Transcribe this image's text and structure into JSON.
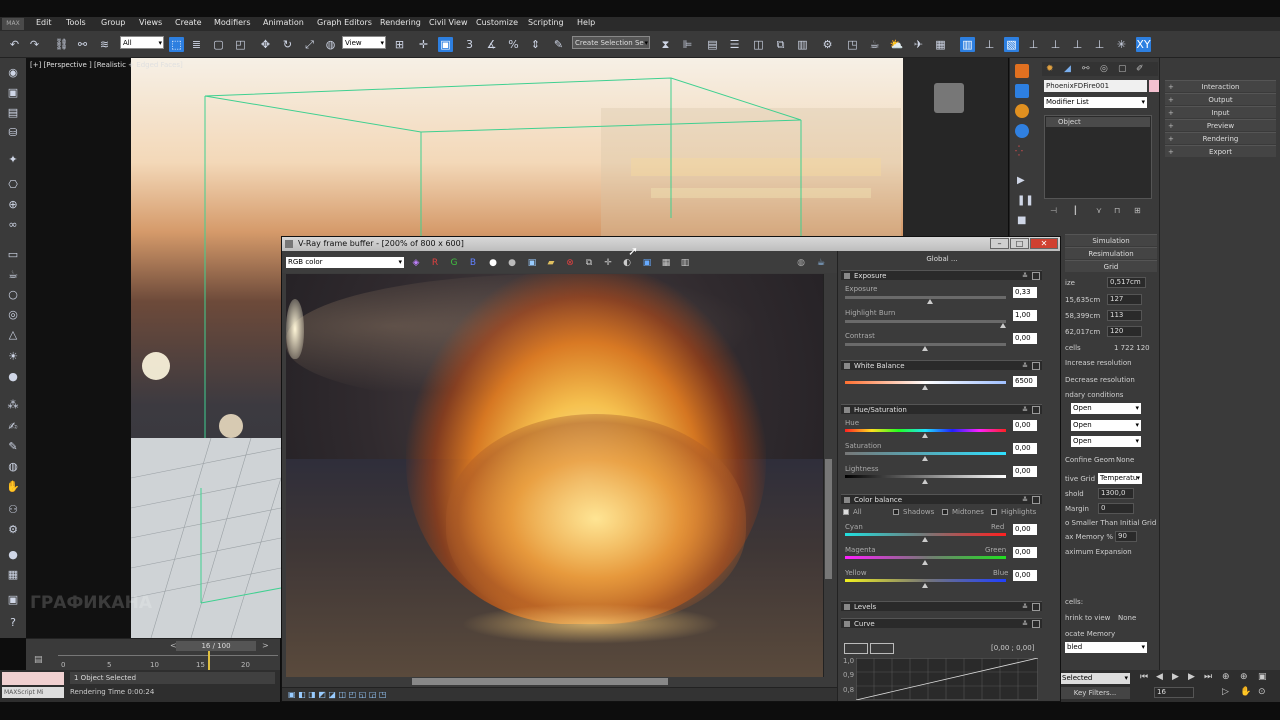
{
  "menu": {
    "logo": "MAX",
    "items": [
      "Edit",
      "Tools",
      "Group",
      "Views",
      "Create",
      "Modifiers",
      "Animation",
      "Graph Editors",
      "Rendering",
      "Civil View",
      "Customize",
      "Scripting",
      "Help"
    ]
  },
  "toolbar": {
    "selection_filter": "All",
    "ref_coord": "View",
    "named_selection": "Create Selection Se"
  },
  "viewport": {
    "label": "[+] [Perspective ] [Realistic + Edged Faces]"
  },
  "timeline": {
    "frame": "16 / 100",
    "ticks": [
      "0",
      "5",
      "10",
      "15",
      "20"
    ]
  },
  "status": {
    "selected": "1 Object Selected",
    "render_time": "Rendering Time 0:00:24",
    "script_label": "MAXScript Mi"
  },
  "bottom_right": {
    "key_mode": "Selected",
    "key_filters": "Key Filters...",
    "frame_field": "16"
  },
  "vfb": {
    "title": "V-Ray frame buffer - [200% of 800 x 600]",
    "channel": "RGB color",
    "rgb": [
      "R",
      "G",
      "B"
    ],
    "global_label": "Global ...",
    "exposure": {
      "name": "Exposure",
      "exposure_label": "Exposure",
      "exposure_val": "0,33",
      "highlight_label": "Highlight Burn",
      "highlight_val": "1,00",
      "contrast_label": "Contrast",
      "contrast_val": "0,00"
    },
    "white_balance": {
      "name": "White Balance",
      "val": "6500"
    },
    "hue_sat": {
      "name": "Hue/Saturation",
      "hue_label": "Hue",
      "hue_val": "0,00",
      "sat_label": "Saturation",
      "sat_val": "0,00",
      "light_label": "Lightness",
      "light_val": "0,00"
    },
    "color_balance": {
      "name": "Color balance",
      "all": "All",
      "shadows": "Shadows",
      "midtones": "Midtones",
      "highlights": "Highlights",
      "cyan": "Cyan",
      "red": "Red",
      "cyan_val": "0,00",
      "magenta": "Magenta",
      "green": "Green",
      "magenta_val": "0,00",
      "yellow": "Yellow",
      "blue": "Blue",
      "yellow_val": "0,00"
    },
    "levels": "Levels",
    "curve": {
      "name": "Curve",
      "coords": "[0,00 ; 0,00]",
      "y1": "1,0",
      "y2": "0,9",
      "y3": "0,8"
    }
  },
  "command_panel": {
    "object_name": "PhoenixFDFire001",
    "modifier_list": "Modifier List",
    "stack_item": "Object",
    "simulation": "Simulation",
    "resimulation": "Resimulation",
    "grid": "Grid",
    "fields": [
      {
        "label": "ize",
        "value": "0,517cm"
      },
      {
        "label": "15,635cm",
        "value": "127"
      },
      {
        "label": "58,399cm",
        "value": "113"
      },
      {
        "label": "62,017cm",
        "value": "120"
      }
    ],
    "cells_label": "cells",
    "cells_value": "1 722 120",
    "increase_res": "Increase resolution",
    "decrease_res": "Decrease resolution",
    "boundary": "ndary conditions",
    "open": [
      "Open",
      "Open",
      "Open"
    ],
    "confine_geom": "Confine Geom",
    "confine_val": "None",
    "adaptive_grid": "tive Grid",
    "adaptive_val": "Temperatu",
    "threshold_label": "shold",
    "threshold_val": "1300,0",
    "margin_label": "Margin",
    "margin_val": "0",
    "no_smaller": "o Smaller Than Initial Grid",
    "max_memory": "ax Memory %",
    "max_memory_val": "90",
    "max_expansion": "aximum Expansion",
    "cells2": "cells:",
    "shrink": "hrink to view",
    "shrink_val": "None",
    "allocate": "ocate Memory",
    "allocate_val": "bled"
  },
  "right_panel": {
    "items": [
      "Interaction",
      "Output",
      "Input",
      "Preview",
      "Rendering",
      "Export"
    ]
  },
  "watermark": "ГРАФИКАНА"
}
